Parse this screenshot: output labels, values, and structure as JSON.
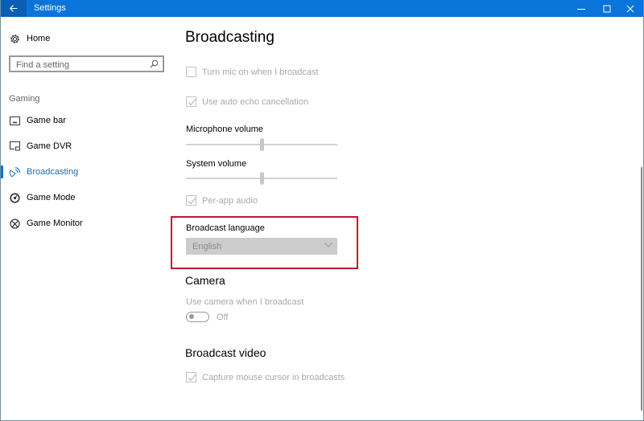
{
  "window": {
    "title": "Settings",
    "controls": {
      "minimize": "minimize-icon",
      "maximize": "maximize-icon",
      "close": "close-icon"
    }
  },
  "sidebar": {
    "home_label": "Home",
    "search_placeholder": "Find a setting",
    "section_label": "Gaming",
    "items": [
      {
        "label": "Game bar",
        "icon": "game-bar-icon",
        "active": false
      },
      {
        "label": "Game DVR",
        "icon": "game-dvr-icon",
        "active": false
      },
      {
        "label": "Broadcasting",
        "icon": "broadcasting-icon",
        "active": true
      },
      {
        "label": "Game Mode",
        "icon": "game-mode-icon",
        "active": false
      },
      {
        "label": "Game Monitor",
        "icon": "xbox-icon",
        "active": false
      }
    ]
  },
  "main": {
    "title": "Broadcasting",
    "turn_mic": {
      "label": "Turn mic on when I broadcast",
      "checked": false,
      "disabled": true
    },
    "echo_cancel": {
      "label": "Use auto echo cancellation",
      "checked": true,
      "disabled": true
    },
    "mic_volume": {
      "label": "Microphone volume",
      "value_percent": 50
    },
    "system_volume": {
      "label": "System volume",
      "value_percent": 50
    },
    "per_app_audio": {
      "label": "Per-app audio",
      "checked": true,
      "disabled": true
    },
    "broadcast_language": {
      "label": "Broadcast language",
      "value": "English",
      "disabled": true
    },
    "camera": {
      "header": "Camera",
      "use_camera_label": "Use camera when I broadcast",
      "toggle_state": "Off"
    },
    "broadcast_video": {
      "header": "Broadcast video",
      "capture_cursor": {
        "label": "Capture mouse cursor in broadcasts",
        "checked": true,
        "disabled": true
      }
    }
  },
  "colors": {
    "titlebar": "#0a74da",
    "accent": "#1a6fb0",
    "highlight_border": "#c8102e"
  }
}
